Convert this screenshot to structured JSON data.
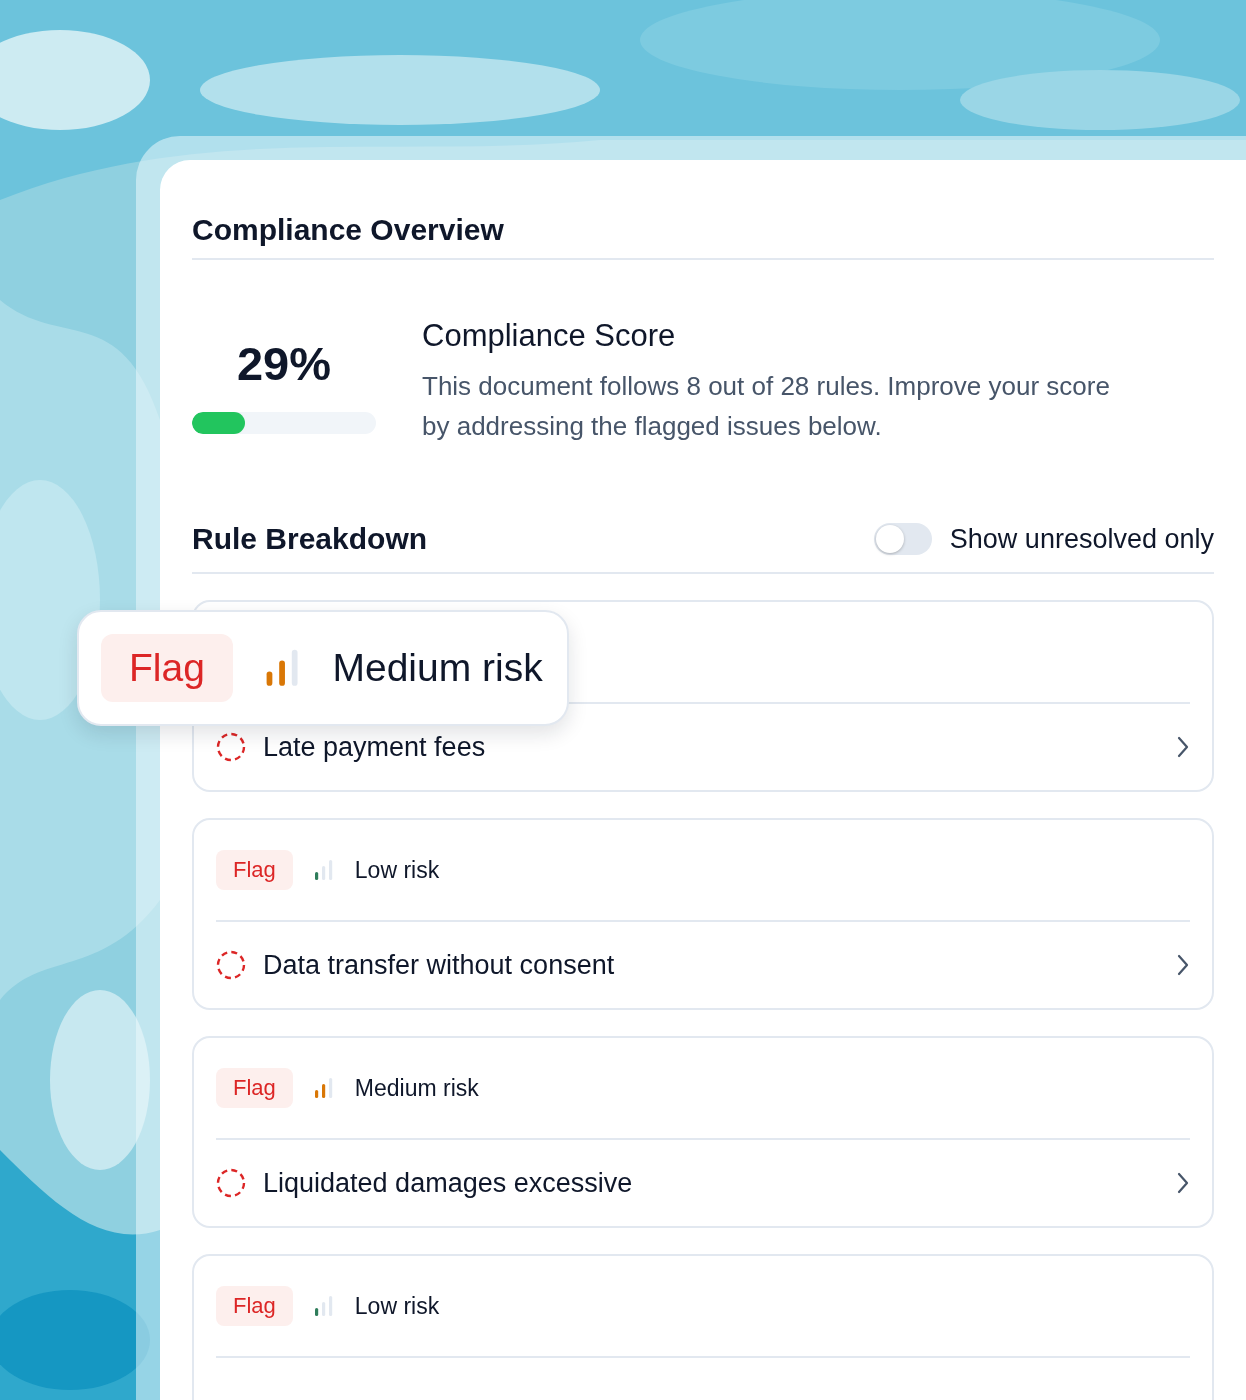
{
  "header": {
    "title": "Compliance Overview"
  },
  "score": {
    "value": "29%",
    "level": 0.29,
    "title": "Compliance Score",
    "description": "This document follows 8 out of 28 rules. Improve your score by addressing the flagged issues below."
  },
  "breakdown": {
    "title": "Rule Breakdown",
    "toggle": {
      "label": "Show unresolved only",
      "on": false
    }
  },
  "callout": {
    "tag": "Flag",
    "kind": "medium",
    "risk_label": "Medium risk"
  },
  "rules": [
    {
      "title": "Late payment fees"
    },
    {
      "tag": "Flag",
      "kind": "low",
      "risk_label": "Low risk",
      "title": "Data transfer without consent"
    },
    {
      "tag": "Flag",
      "kind": "medium",
      "risk_label": "Medium risk",
      "title": "Liquidated damages excessive"
    },
    {
      "tag": "Flag",
      "kind": "low",
      "risk_label": "Low risk"
    }
  ]
}
